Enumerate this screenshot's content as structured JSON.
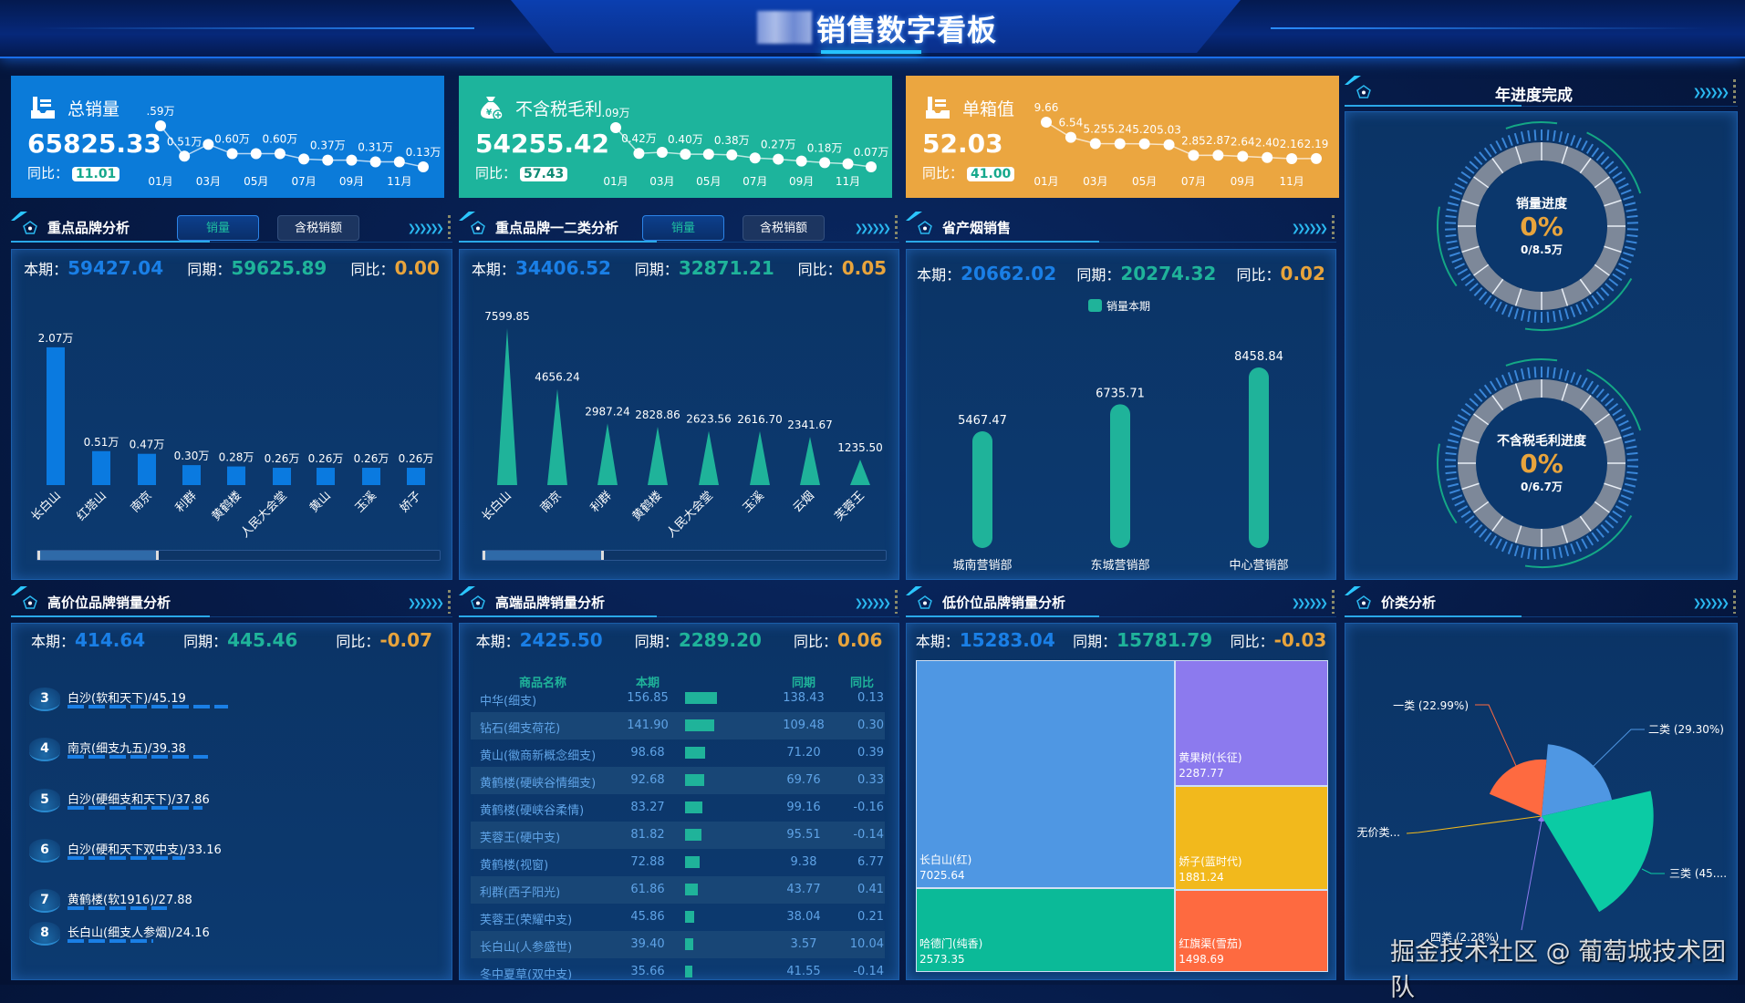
{
  "header": {
    "title": "销售数字看板"
  },
  "stat_labels": {
    "current": "本期：",
    "prior": "同期：",
    "yoy": "同比："
  },
  "kpis": [
    {
      "title": "总销量",
      "value": "65825.33",
      "yoy_label": "同比：",
      "yoy": "11.01",
      "icon": "inbox-tray-icon",
      "color": "#0b7bd9",
      "badge_text_color": "#16a88c"
    },
    {
      "title": "不含税毛利",
      "value": "54255.42",
      "yoy_label": "同比：",
      "yoy": "57.43",
      "icon": "money-bag-icon",
      "color": "#1db49c",
      "badge_text_color": "#0f8a74"
    },
    {
      "title": "单箱值",
      "value": "52.03",
      "yoy_label": "同比：",
      "yoy": "41.00",
      "icon": "inbox-tray-icon",
      "color": "#eba640",
      "badge_text_color": "#16a88c"
    }
  ],
  "panels": {
    "key_brand": {
      "title": "重点品牌分析",
      "tabs": [
        "销量",
        "含税销额"
      ],
      "active_tab": "销量",
      "current": "59427.04",
      "prior": "59625.89",
      "yoy": "0.00"
    },
    "key_brand_class": {
      "title": "重点品牌一二类分析",
      "tabs": [
        "销量",
        "含税销额"
      ],
      "active_tab": "销量",
      "current": "34406.52",
      "prior": "32871.21",
      "yoy": "0.05"
    },
    "province": {
      "title": "省产烟销售",
      "current": "20662.02",
      "prior": "20274.32",
      "yoy": "0.02"
    },
    "year_progress": {
      "title": "年进度完成"
    },
    "high_price": {
      "title": "高价位品牌销量分析",
      "current": "414.64",
      "prior": "445.46",
      "yoy": "-0.07",
      "items": [
        {
          "rank": "3",
          "label": "白沙(软和天下)/45.19",
          "value": 45.19
        },
        {
          "rank": "4",
          "label": "南京(细支九五)/39.38",
          "value": 39.38
        },
        {
          "rank": "5",
          "label": "白沙(硬细支和天下)/37.86",
          "value": 37.86
        },
        {
          "rank": "6",
          "label": "白沙(硬和天下双中支)/33.16",
          "value": 33.16
        },
        {
          "rank": "7",
          "label": "黄鹤楼(软1916)/27.88",
          "value": 27.88
        },
        {
          "rank": "8",
          "label": "长白山(细支人参烟)/24.16",
          "value": 24.16
        }
      ]
    },
    "high_end": {
      "title": "高端品牌销量分析",
      "current": "2425.50",
      "prior": "2289.20",
      "yoy": "0.06"
    },
    "low_price": {
      "title": "低价位品牌销量分析",
      "current": "15283.04",
      "prior": "15781.79",
      "yoy": "-0.03"
    },
    "price_class": {
      "title": "价类分析"
    }
  },
  "gauges": [
    {
      "label": "销量进度",
      "percent": "0%",
      "ratio": "0/8.5万",
      "progress": 0
    },
    {
      "label": "不含税毛利进度",
      "percent": "0%",
      "ratio": "0/6.7万",
      "progress": 0
    }
  ],
  "table": {
    "columns": [
      "商品名称",
      "本期",
      "同期",
      "同比"
    ],
    "rows": [
      [
        "中华(细支)",
        "156.85",
        "138.43",
        "0.13"
      ],
      [
        "钻石(细支荷花)",
        "141.90",
        "109.48",
        "0.30"
      ],
      [
        "黄山(徽商新概念细支)",
        "98.68",
        "71.20",
        "0.39"
      ],
      [
        "黄鹤楼(硬峡谷情细支)",
        "92.68",
        "69.76",
        "0.33"
      ],
      [
        "黄鹤楼(硬峡谷柔情)",
        "83.27",
        "99.16",
        "-0.16"
      ],
      [
        "芙蓉王(硬中支)",
        "81.82",
        "95.51",
        "-0.14"
      ],
      [
        "黄鹤楼(视窗)",
        "72.88",
        "9.38",
        "6.77"
      ],
      [
        "利群(西子阳光)",
        "61.86",
        "43.77",
        "0.41"
      ],
      [
        "芙蓉王(荣耀中支)",
        "45.86",
        "38.04",
        "0.21"
      ],
      [
        "长白山(人参盛世)",
        "39.40",
        "3.57",
        "10.04"
      ],
      [
        "冬中夏草(双中支)",
        "35.66",
        "41.55",
        "-0.14"
      ]
    ]
  },
  "watermark": "掘金技术社区 @ 葡萄城技术团队",
  "chart_data": [
    {
      "id": "total-sales-trend",
      "type": "line",
      "x_tick_labels": [
        "01月",
        "03月",
        "05月",
        "07月",
        "09月",
        "11月"
      ],
      "values": [
        1.59,
        0.51,
        0.93,
        0.6,
        0.6,
        0.6,
        0.41,
        0.37,
        0.37,
        0.31,
        0.31,
        0.13
      ],
      "labels": [
        ".59万",
        "0.51万",
        null,
        "0.60万",
        null,
        "0.60万",
        null,
        "0.37万",
        null,
        "0.31万",
        null,
        "0.13万"
      ],
      "unit": "万"
    },
    {
      "id": "gross-profit-trend",
      "type": "line",
      "x_tick_labels": [
        "01月",
        "03月",
        "05月",
        "07月",
        "09月",
        "11月"
      ],
      "values": [
        1.09,
        0.42,
        0.45,
        0.4,
        0.4,
        0.38,
        0.3,
        0.27,
        0.22,
        0.18,
        0.15,
        0.07
      ],
      "labels": [
        ".09万",
        "0.42万",
        null,
        "0.40万",
        null,
        "0.38万",
        null,
        "0.27万",
        null,
        "0.18万",
        null,
        "0.07万"
      ],
      "unit": "万"
    },
    {
      "id": "case-value-trend",
      "type": "line",
      "x_tick_labels": [
        "01月",
        "03月",
        "05月",
        "07月",
        "09月",
        "11月"
      ],
      "values": [
        9.66,
        6.54,
        5.25,
        5.24,
        5.2,
        5.03,
        2.85,
        2.87,
        2.64,
        2.4,
        2.16,
        2.19
      ],
      "labels": [
        "9.66",
        "6.54",
        "5.25",
        "5.24",
        "5.20",
        "5.03",
        "2.85",
        "2.87",
        "2.64",
        "2.40",
        "2.16",
        "2.19"
      ]
    },
    {
      "id": "key-brand-bar",
      "type": "bar",
      "categories": [
        "长白山",
        "红塔山",
        "南京",
        "利群",
        "黄鹤楼",
        "人民大会堂",
        "黄山",
        "玉溪",
        "娇子"
      ],
      "values": [
        2.07,
        0.51,
        0.47,
        0.3,
        0.28,
        0.26,
        0.26,
        0.26,
        0.26
      ],
      "labels": [
        "2.07万",
        "0.51万",
        "0.47万",
        "0.30万",
        "0.28万",
        "0.26万",
        "0.26万",
        "0.26万",
        "0.26万"
      ],
      "unit": "万",
      "color": "#0a7ae0",
      "zoom_window": [
        0,
        30
      ]
    },
    {
      "id": "key-brand-class-bar",
      "type": "bar",
      "shape": "triangle",
      "categories": [
        "长白山",
        "南京",
        "利群",
        "黄鹤楼",
        "人民大会堂",
        "玉溪",
        "云烟",
        "芙蓉王"
      ],
      "values": [
        7599.85,
        4656.24,
        2987.24,
        2828.86,
        2623.56,
        2616.7,
        2341.67,
        1235.5
      ],
      "color": "#1fb39a",
      "zoom_window": [
        0,
        30
      ]
    },
    {
      "id": "province-bar",
      "type": "bar",
      "categories": [
        "城南营销部",
        "东城营销部",
        "中心营销部"
      ],
      "series": [
        {
          "name": "销量本期",
          "values": [
            5467.47,
            6735.71,
            8458.84
          ]
        }
      ],
      "legend": "top",
      "color": "#1fb39a"
    },
    {
      "id": "low-price-treemap",
      "type": "treemap",
      "items": [
        {
          "name": "长白山(红)",
          "value": 7025.64,
          "color": "#4f97e3"
        },
        {
          "name": "哈德门(纯香)",
          "value": 2573.35,
          "color": "#0bba98"
        },
        {
          "name": "黄果树(长征)",
          "value": 2287.77,
          "color": "#8c7aee"
        },
        {
          "name": "娇子(蓝时代)",
          "value": 1881.24,
          "color": "#f2b91c"
        },
        {
          "name": "红旗渠(雪茄)",
          "value": 1498.69,
          "color": "#fe6a40"
        }
      ]
    },
    {
      "id": "price-class-rose",
      "type": "pie",
      "rose": "area",
      "slices": [
        {
          "name": "二类",
          "label": "二类 (29.30%)",
          "value": 29.3,
          "color": "#4f97e3"
        },
        {
          "name": "三类",
          "label": "三类 (45....",
          "value": 45.43,
          "color": "#0bcba4"
        },
        {
          "name": "四类",
          "label": "四类 (2.28%)",
          "value": 2.28,
          "color": "#8c7aee"
        },
        {
          "name": "无价类",
          "label": "无价类...",
          "value": 0,
          "color": "#f2b91c"
        },
        {
          "name": "一类",
          "label": "一类 (22.99%)",
          "value": 22.99,
          "color": "#fe6a40"
        }
      ]
    }
  ]
}
